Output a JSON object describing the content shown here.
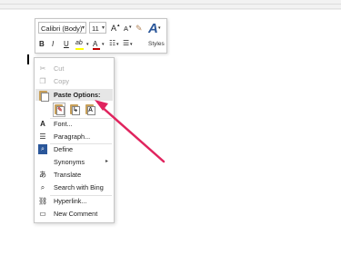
{
  "mini_toolbar": {
    "font_name": "Calibri (Body)",
    "font_size": "11",
    "grow_font": "A",
    "shrink_font": "A",
    "bold": "B",
    "italic": "I",
    "underline": "U",
    "highlight": "ab",
    "font_color": "A",
    "styles_label": "Styles",
    "styles_glyph": "A",
    "accent_color": "#2b579a",
    "font_color_bar": "#c00000",
    "highlight_bar": "#ffff00"
  },
  "context_menu": {
    "cut": "Cut",
    "copy": "Copy",
    "paste_options": "Paste Options:",
    "font": "Font...",
    "paragraph": "Paragraph...",
    "define": "Define",
    "synonyms": "Synonyms",
    "translate": "Translate",
    "search_with_bing": "Search with Bing",
    "hyperlink": "Hyperlink...",
    "new_comment": "New Comment",
    "paste_buttons": [
      "Keep Source Formatting",
      "Merge Formatting",
      "Keep Text Only"
    ]
  },
  "annotation": {
    "arrow_color": "#e0245e"
  }
}
